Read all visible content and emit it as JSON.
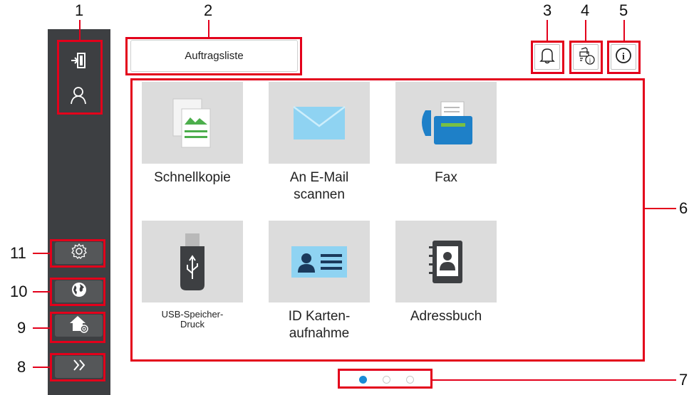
{
  "callouts": [
    "1",
    "2",
    "3",
    "4",
    "5",
    "6",
    "7",
    "8",
    "9",
    "10",
    "11"
  ],
  "header": {
    "job_list_label": "Auftragsliste"
  },
  "sidebar": {
    "icons": [
      "logout-icon",
      "user-icon"
    ],
    "buttons": [
      "settings-gear-icon",
      "language-globe-icon",
      "home-settings-icon",
      "expand-chevron-icon"
    ]
  },
  "top_icons": [
    "bell-icon",
    "device-info-icon",
    "info-icon"
  ],
  "tiles": [
    {
      "label": "Schnellkopie",
      "icon": "copy-icon"
    },
    {
      "label": "An E-Mail\nscannen",
      "icon": "email-icon"
    },
    {
      "label": "Fax",
      "icon": "fax-icon"
    },
    {
      "label": "USB-Speicher-\nDruck",
      "icon": "usb-icon"
    },
    {
      "label": "ID Karten-\naufnahme",
      "icon": "id-card-icon"
    },
    {
      "label": "Adressbuch",
      "icon": "address-book-icon"
    }
  ],
  "pagination": {
    "pages": 3,
    "active": 1
  },
  "colors": {
    "callout_red": "#e3001b",
    "sidebar": "#3d3f42",
    "tile_bg": "#dcdcdc",
    "active_dot": "#1a8bd6"
  }
}
